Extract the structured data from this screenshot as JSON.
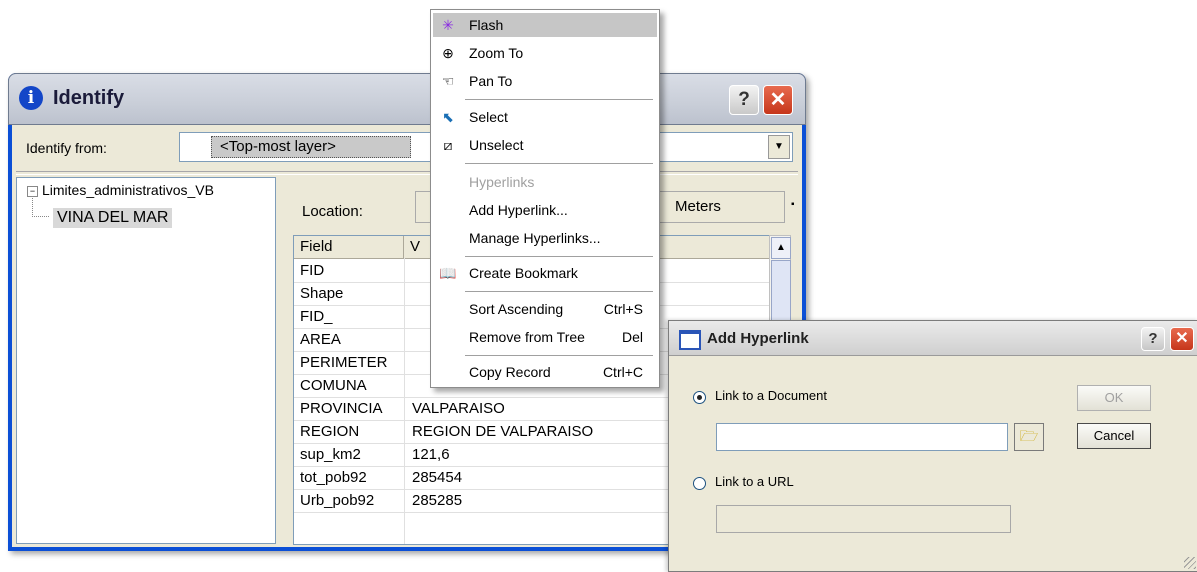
{
  "identify": {
    "title": "Identify",
    "from_label": "Identify from:",
    "from_value": "<Top-most layer>",
    "tree": {
      "layer": "Limites_administrativos_VB",
      "feature": "VINA DEL MAR"
    },
    "location_label": "Location:",
    "location_units": "Meters",
    "columns": [
      "Field",
      "V"
    ],
    "rows": [
      {
        "field": "FID",
        "value": ""
      },
      {
        "field": "Shape",
        "value": ""
      },
      {
        "field": "FID_",
        "value": ""
      },
      {
        "field": "AREA",
        "value": ""
      },
      {
        "field": "PERIMETER",
        "value": ""
      },
      {
        "field": "COMUNA",
        "value": ""
      },
      {
        "field": "PROVINCIA",
        "value": "VALPARAISO"
      },
      {
        "field": "REGION",
        "value": "REGION DE VALPARAISO"
      },
      {
        "field": "sup_km2",
        "value": "121,6"
      },
      {
        "field": "tot_pob92",
        "value": "285454"
      },
      {
        "field": "Urb_pob92",
        "value": "285285"
      }
    ]
  },
  "context_menu": {
    "items": [
      {
        "label": "Flash",
        "icon": "flash-icon",
        "shortcut": ""
      },
      {
        "label": "Zoom To",
        "icon": "zoom-icon",
        "shortcut": ""
      },
      {
        "label": "Pan To",
        "icon": "hand-icon",
        "shortcut": ""
      },
      {
        "label": "Select",
        "icon": "select-icon",
        "shortcut": ""
      },
      {
        "label": "Unselect",
        "icon": "unselect-icon",
        "shortcut": ""
      },
      {
        "label": "Hyperlinks",
        "icon": "",
        "shortcut": ""
      },
      {
        "label": "Add Hyperlink...",
        "icon": "",
        "shortcut": ""
      },
      {
        "label": "Manage Hyperlinks...",
        "icon": "",
        "shortcut": ""
      },
      {
        "label": "Create Bookmark",
        "icon": "bookmark-icon",
        "shortcut": ""
      },
      {
        "label": "Sort Ascending",
        "icon": "",
        "shortcut": "Ctrl+S"
      },
      {
        "label": "Remove from Tree",
        "icon": "",
        "shortcut": "Del"
      },
      {
        "label": "Copy Record",
        "icon": "",
        "shortcut": "Ctrl+C"
      }
    ]
  },
  "add_hyperlink": {
    "title": "Add Hyperlink",
    "link_document_label": "Link to a Document",
    "link_url_label": "Link to a URL",
    "ok_label": "OK",
    "cancel_label": "Cancel"
  },
  "colors": {
    "titlebar_blue": "#0b4fd6",
    "close_red": "#d9452a",
    "menu_highlight": "#c6c6c6"
  }
}
